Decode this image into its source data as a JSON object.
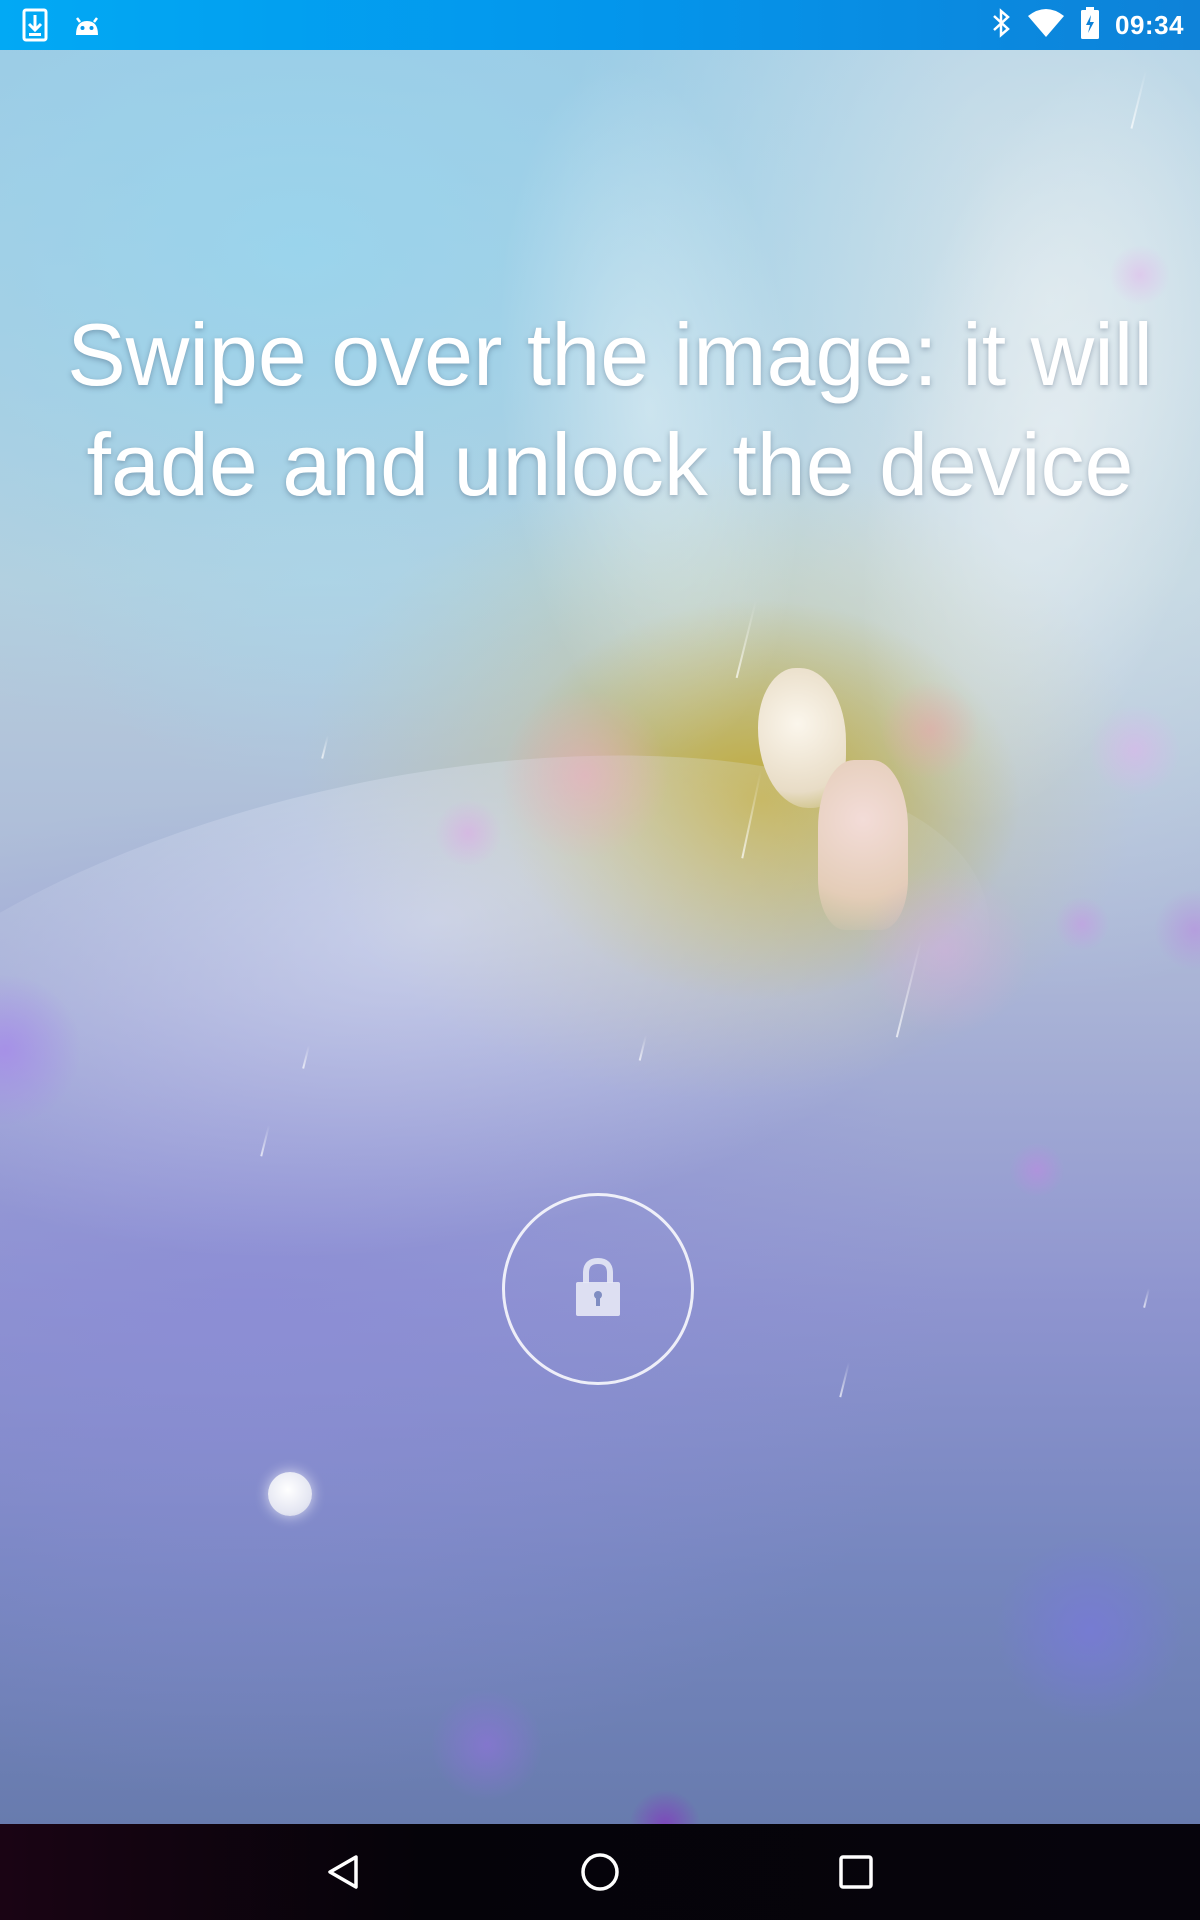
{
  "status_bar": {
    "time": "09:34",
    "left_icons": [
      "download-icon",
      "android-icon"
    ],
    "right_icons": [
      "bluetooth-icon",
      "wifi-icon",
      "battery-icon"
    ],
    "background_color": "#03A9F4"
  },
  "lock_screen": {
    "instruction": "Swipe over the image: it will fade and unlock the device",
    "lock_icon": "padlock-icon"
  },
  "nav_bar": {
    "buttons": [
      "back-icon",
      "home-icon",
      "recents-icon"
    ]
  }
}
